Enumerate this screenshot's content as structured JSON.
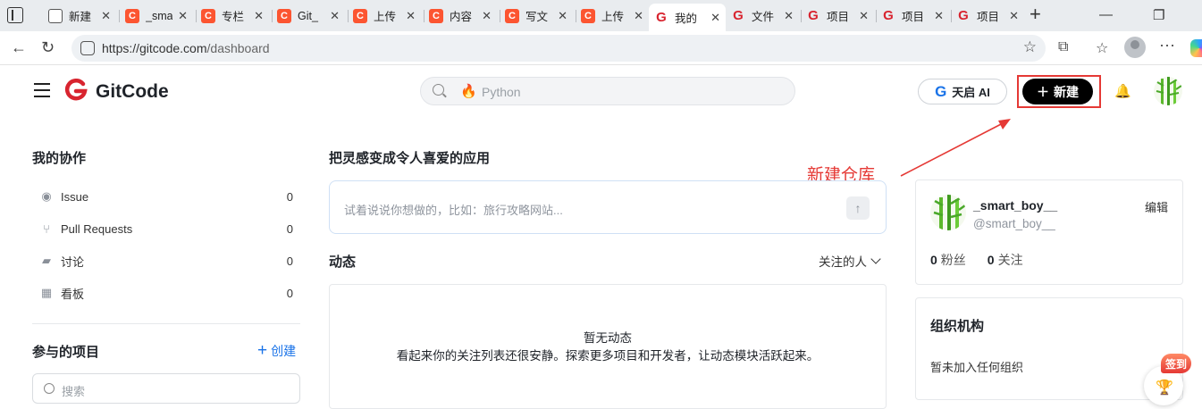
{
  "browser": {
    "tabs": [
      {
        "title": "新建",
        "favicon": "page-icon"
      },
      {
        "title": "_sma",
        "favicon": "csdn-icon"
      },
      {
        "title": "专栏",
        "favicon": "csdn-icon"
      },
      {
        "title": "Git_",
        "favicon": "csdn-icon"
      },
      {
        "title": "上传",
        "favicon": "csdn-icon"
      },
      {
        "title": "内容",
        "favicon": "csdn-icon"
      },
      {
        "title": "写文",
        "favicon": "csdn-icon"
      },
      {
        "title": "上传",
        "favicon": "csdn-icon"
      },
      {
        "title": "我的",
        "favicon": "gitcode-icon",
        "active": true
      },
      {
        "title": "文件",
        "favicon": "gitcode-icon"
      },
      {
        "title": "项目",
        "favicon": "gitcode-icon"
      },
      {
        "title": "项目",
        "favicon": "gitcode-icon"
      },
      {
        "title": "项目",
        "favicon": "gitcode-icon"
      }
    ],
    "url_host": "https://gitcode.com",
    "url_path": "/dashboard"
  },
  "header": {
    "logo_text": "GitCode",
    "search_placeholder": "Python",
    "ai_button_label": "天启 AI",
    "new_button_label": "新建"
  },
  "annotation": {
    "label": "新建仓库",
    "color": "#e53935"
  },
  "sidebar": {
    "collab_title": "我的协作",
    "items": [
      {
        "label": "Issue",
        "count": "0",
        "icon": "issue-icon"
      },
      {
        "label": "Pull Requests",
        "count": "0",
        "icon": "pull-request-icon"
      },
      {
        "label": "讨论",
        "count": "0",
        "icon": "discussion-icon"
      },
      {
        "label": "看板",
        "count": "0",
        "icon": "board-icon"
      }
    ],
    "projects_title": "参与的项目",
    "create_label": "创建",
    "search_placeholder": "搜索"
  },
  "main": {
    "ai_title": "把灵感变成令人喜爱的应用",
    "ai_placeholder": "试着说说你想做的，比如：旅行攻略网站...",
    "feed_title": "动态",
    "feed_filter": "关注的人",
    "empty_title": "暂无动态",
    "empty_desc": "看起来你的关注列表还很安静。探索更多项目和开发者，让动态模块活跃起来。"
  },
  "profile": {
    "username": "_smart_boy__",
    "handle": "@smart_boy__",
    "edit_label": "编辑",
    "followers_count": "0",
    "followers_label": "粉丝",
    "following_count": "0",
    "following_label": "关注"
  },
  "org": {
    "title": "组织机构",
    "empty": "暂未加入任何组织"
  },
  "signin": {
    "label": "签到"
  },
  "colors": {
    "brand": "#d8242f",
    "link": "#1a73e8",
    "annotation": "#e53935"
  }
}
